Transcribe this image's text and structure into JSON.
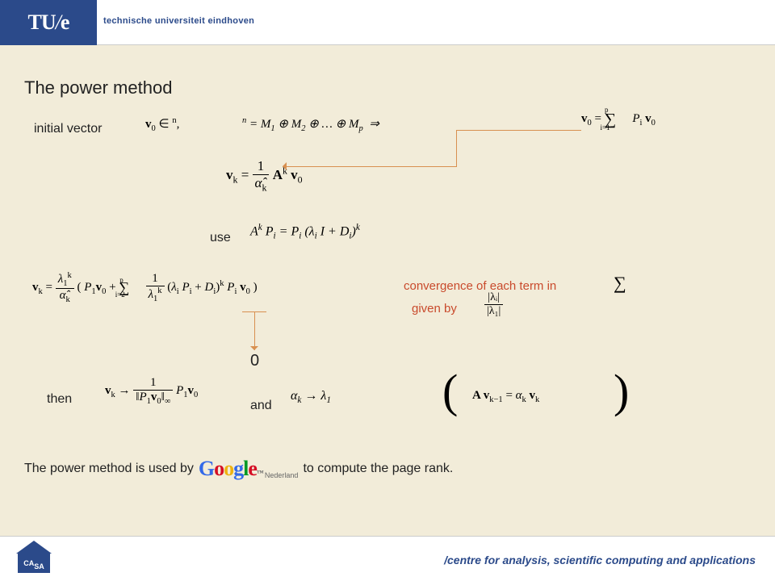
{
  "header": {
    "logo": "TU/e",
    "university": "technische universiteit eindhoven"
  },
  "slide": {
    "title": "The power method",
    "initial_vector_label": "initial vector",
    "math_v0": "𝐯₀ ∈ ℝⁿ,",
    "math_decomp": "ℝⁿ = M₁ ⊕ M₂ ⊕ … ⊕ Mₚ  ⇒",
    "math_sum_label": "𝐯₀ =",
    "math_vk_formula": "𝐯ₖ = (1/α̂ₖ) 𝐀ᵏ 𝐯₀",
    "use_label": "use",
    "math_use": "Aᵏ Pᵢ = Pᵢ (λᵢ I + Dᵢ)ᵏ",
    "math_expand": "𝐯ₖ = (λ₁ᵏ/α̂ₖ)( P₁𝐯₀ + Σᵢ₌₂ᵖ (1/λ₁ᵏ)(λᵢ Pᵢ + Dᵢ)ᵏ Pᵢ 𝐯₀ )",
    "conv_line1": "convergence of each term in",
    "conv_sigma": "∑",
    "conv_line2": "given by",
    "conv_ratio_num": "|λᵢ|",
    "conv_ratio_den": "|λ₁|",
    "zero": "0",
    "then_label": "then",
    "math_then": "𝐯ₖ → (1/‖P₁𝐯₀‖∞) P₁𝐯₀",
    "and_label": "and",
    "math_and": "αₖ → λ₁",
    "paren_open": "(",
    "math_paren_inner": "𝐀𝐯ₖ₋₁ = αₖ 𝐯ₖ",
    "paren_close": ")",
    "google_before": "The power method is used by",
    "google_after": "to compute the page rank.",
    "google_sub": "Nederland",
    "google_tm": "™"
  },
  "footer": {
    "casa": "CASA",
    "text": "/centre for analysis, scientific computing and applications"
  }
}
